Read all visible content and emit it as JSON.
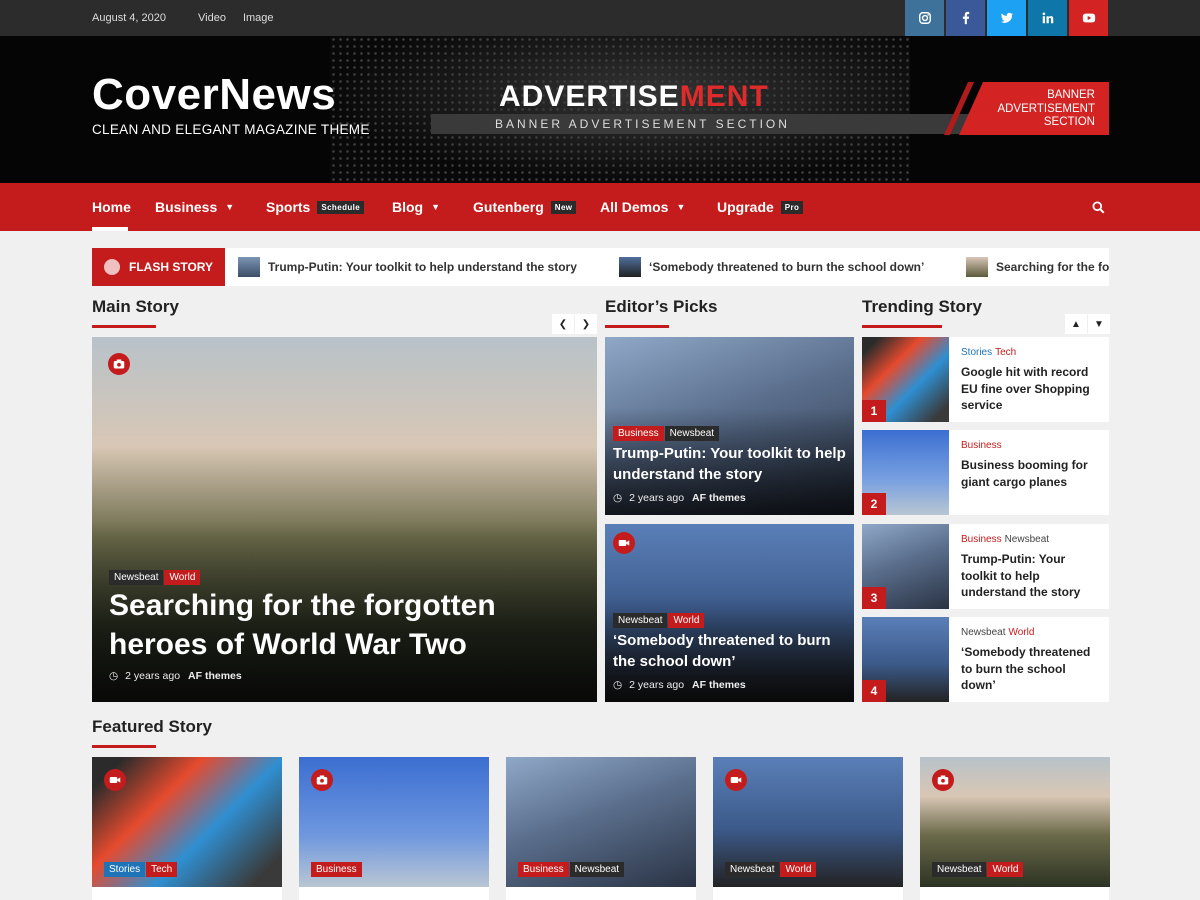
{
  "topbar": {
    "date": "August 4, 2020",
    "links": [
      "Video",
      "Image"
    ],
    "social": [
      {
        "icon": "instagram-icon",
        "color": "#3f729b"
      },
      {
        "icon": "facebook-icon",
        "color": "#3b5998"
      },
      {
        "icon": "twitter-icon",
        "color": "#1da1f2"
      },
      {
        "icon": "linkedin-icon",
        "color": "#0e76a8"
      },
      {
        "icon": "youtube-icon",
        "color": "#d32323"
      }
    ]
  },
  "brand": {
    "name": "CoverNews",
    "tagline": "CLEAN AND ELEGANT MAGAZINE THEME"
  },
  "advertisement": {
    "title_white": "ADVERTISE",
    "title_red": "MENT",
    "subtitle": "BANNER ADVERTISEMENT SECTION",
    "side_text": [
      "BANNER",
      "ADVERTISEMENT",
      "SECTION"
    ]
  },
  "nav": {
    "items": [
      {
        "label": "Home"
      },
      {
        "label": "Business",
        "caret": true
      },
      {
        "label": "Sports",
        "pill": "Schedule"
      },
      {
        "label": "Blog",
        "caret": true
      },
      {
        "label": "Gutenberg",
        "pill": "New"
      },
      {
        "label": "All Demos",
        "caret": true
      },
      {
        "label": "Upgrade",
        "pill": "Pro"
      }
    ],
    "search_icon": "search-icon"
  },
  "ticker": {
    "label": "FLASH STORY",
    "items": [
      "Trump-Putin: Your toolkit to help understand the story",
      "‘Somebody threatened to burn the school down’",
      "Searching for the for"
    ]
  },
  "main_story": {
    "heading": "Main Story",
    "categories": [
      "Newsbeat",
      "World"
    ],
    "title": "Searching for the forgotten heroes of World War Two",
    "time": "2 years ago",
    "author": "AF themes"
  },
  "editors_picks": {
    "heading": "Editor’s Picks",
    "posts": [
      {
        "categories": [
          "Business",
          "Newsbeat"
        ],
        "title": "Trump-Putin: Your toolkit to help understand the story",
        "time": "2 years ago",
        "author": "AF themes"
      },
      {
        "categories": [
          "Newsbeat",
          "World"
        ],
        "title": "‘Somebody threatened to burn the school down’",
        "time": "2 years ago",
        "author": "AF themes"
      }
    ]
  },
  "trending": {
    "heading": "Trending Story",
    "posts": [
      {
        "num": "1",
        "categories": [
          "Stories",
          "Tech"
        ],
        "title": "Google hit with record EU fine over Shopping service"
      },
      {
        "num": "2",
        "categories": [
          "Business"
        ],
        "title": "Business booming for giant cargo planes"
      },
      {
        "num": "3",
        "categories": [
          "Business",
          "Newsbeat"
        ],
        "title": "Trump-Putin: Your toolkit to help understand the story"
      },
      {
        "num": "4",
        "categories": [
          "Newsbeat",
          "World"
        ],
        "title": "‘Somebody threatened to burn the school down’"
      }
    ]
  },
  "featured": {
    "heading": "Featured Story",
    "posts": [
      {
        "categories": [
          "Stories",
          "Tech"
        ]
      },
      {
        "categories": [
          "Business"
        ]
      },
      {
        "categories": [
          "Business",
          "Newsbeat"
        ]
      },
      {
        "categories": [
          "Newsbeat",
          "World"
        ]
      },
      {
        "categories": [
          "Newsbeat",
          "World"
        ]
      }
    ]
  },
  "colors": {
    "accent": "#c41c1c",
    "dark": "#2c2c2c",
    "blue_cat": "#1f73b7"
  }
}
